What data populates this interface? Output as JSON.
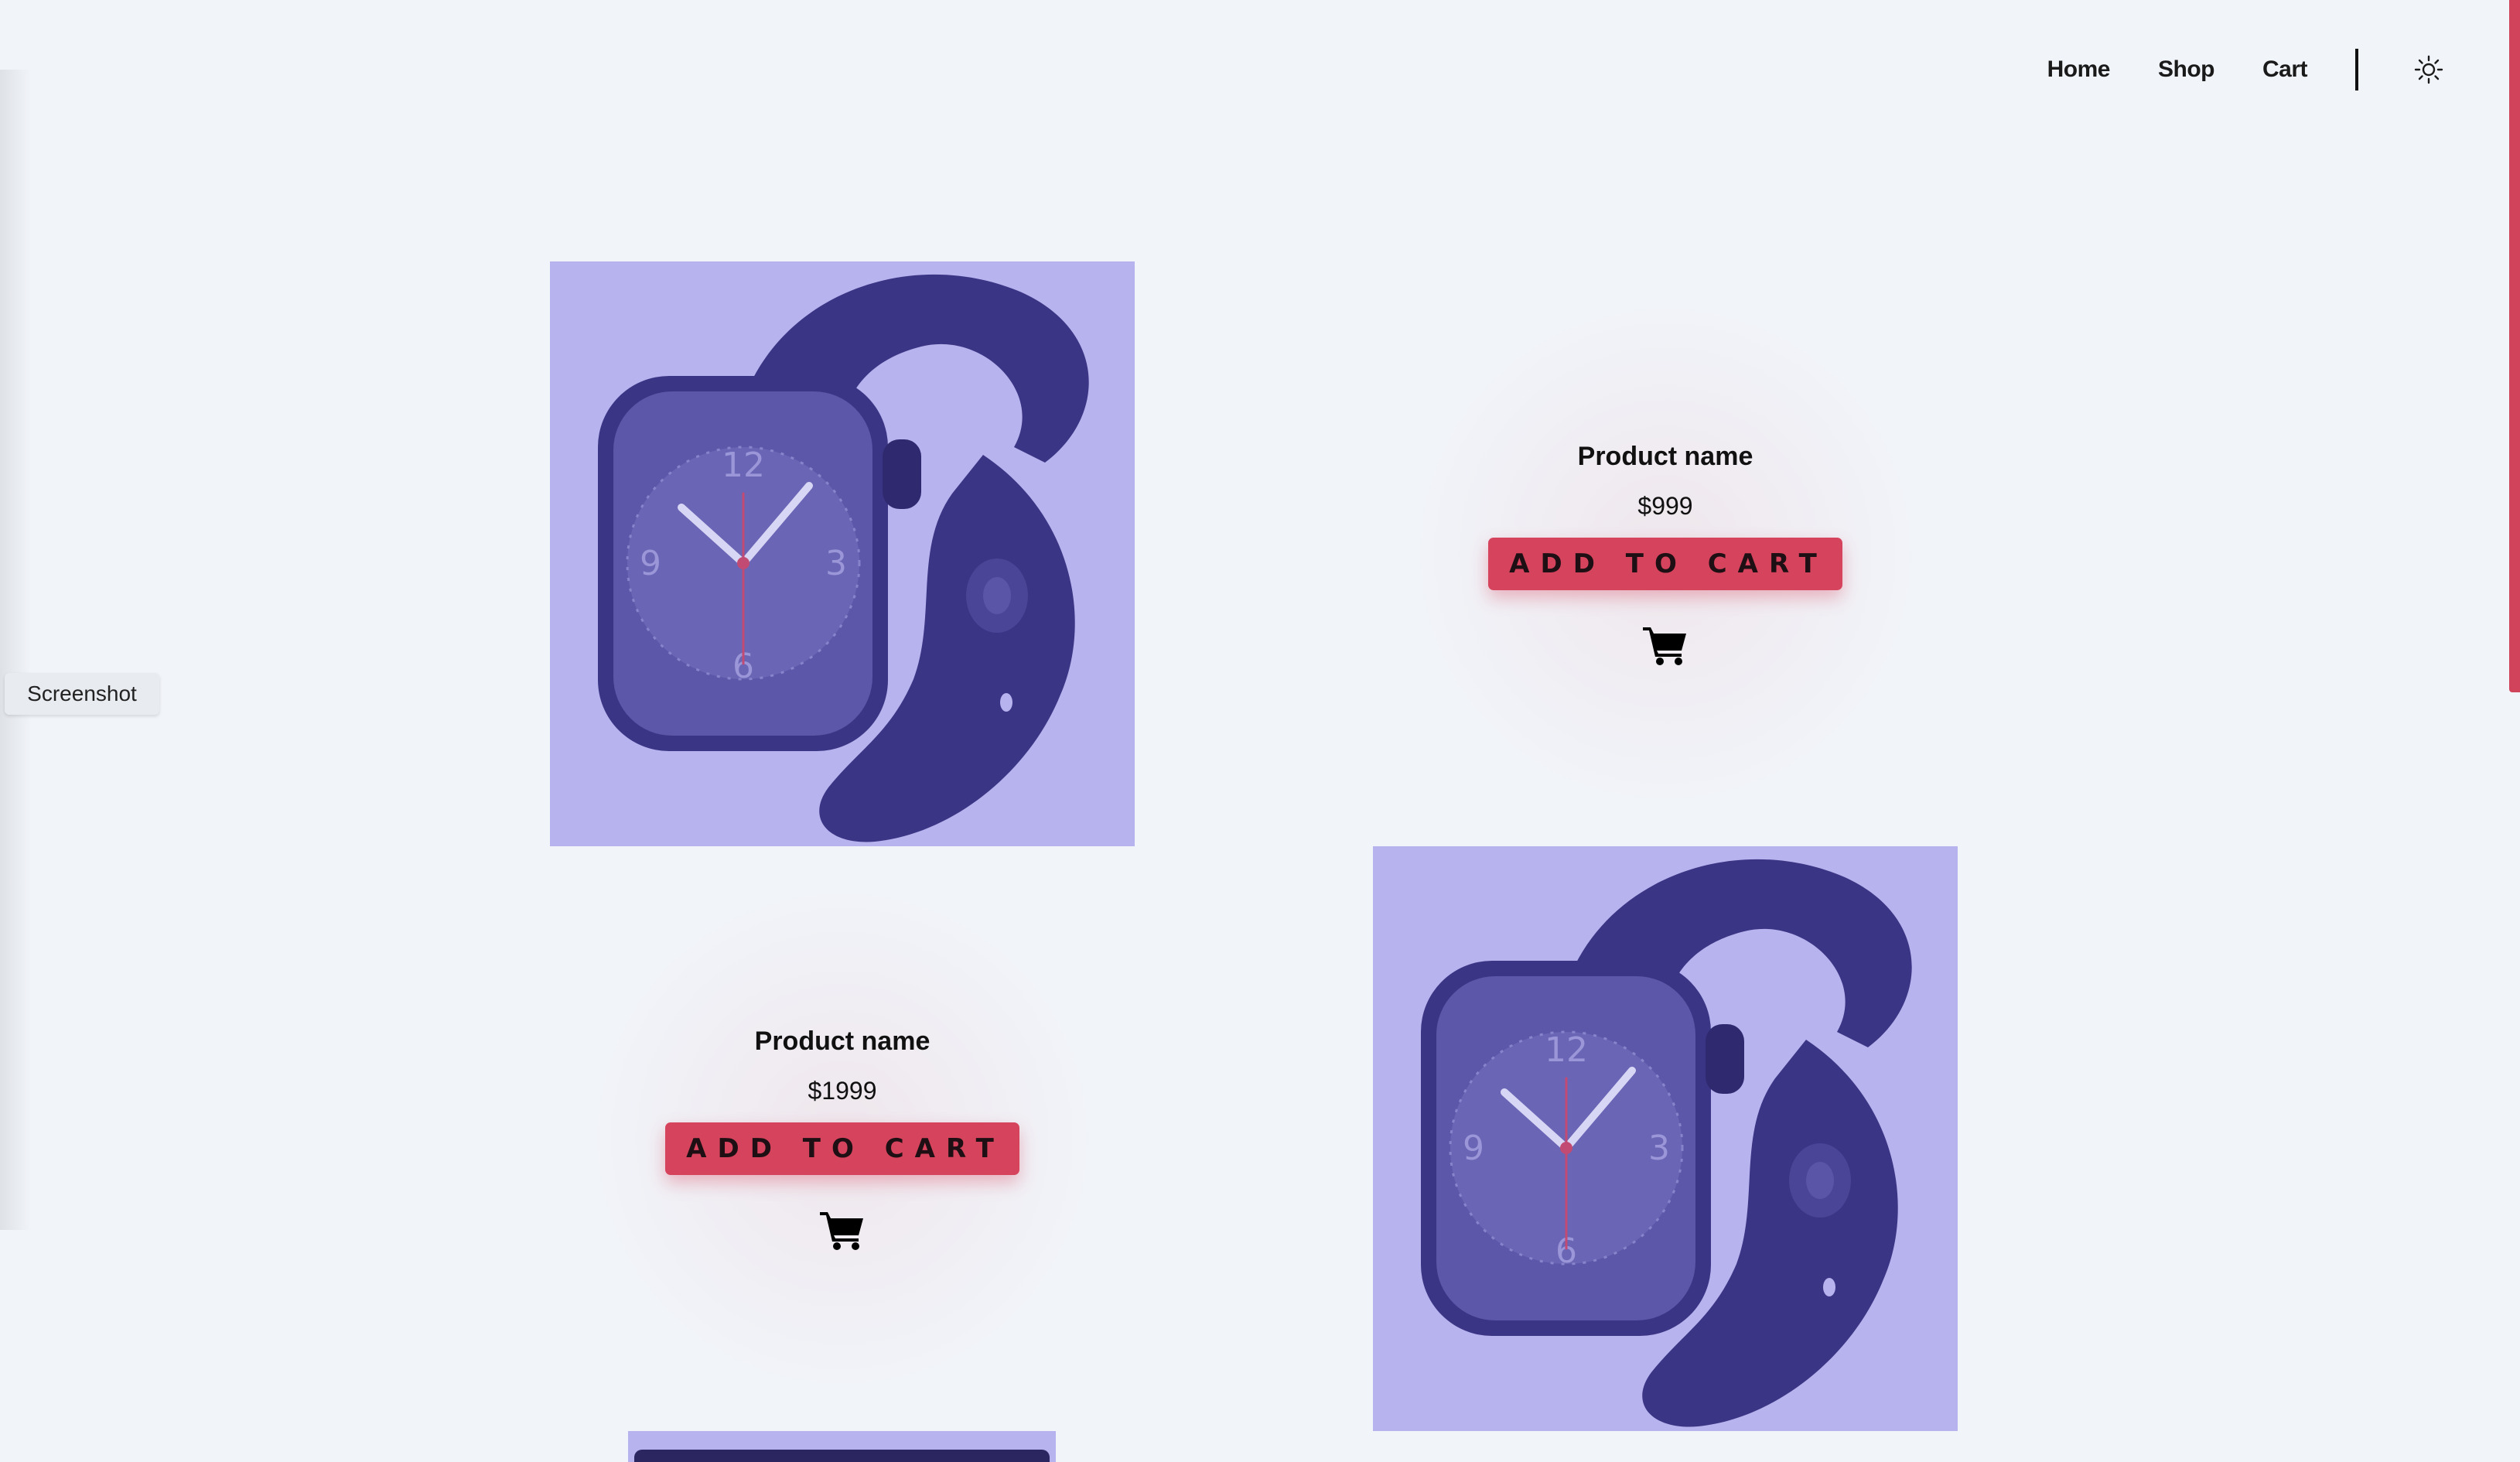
{
  "nav": {
    "items": [
      {
        "label": "Home"
      },
      {
        "label": "Shop"
      },
      {
        "label": "Cart"
      }
    ],
    "theme_icon": "sun-icon"
  },
  "overlay": {
    "screenshot_label": "Screenshot"
  },
  "products": [
    {
      "name": "Product name",
      "price": "$999",
      "button_label": "ADD TO CART",
      "cart_icon": "cart-icon",
      "image_icon": "smartwatch-image"
    },
    {
      "name": "Product name",
      "price": "$1999",
      "button_label": "ADD TO CART",
      "cart_icon": "cart-icon",
      "image_icon": "smartwatch-image"
    }
  ],
  "colors": {
    "background": "#f1f4f9",
    "image_bg": "#b7b3ee",
    "watch": "#3b3585",
    "accent": "#d6435c"
  }
}
